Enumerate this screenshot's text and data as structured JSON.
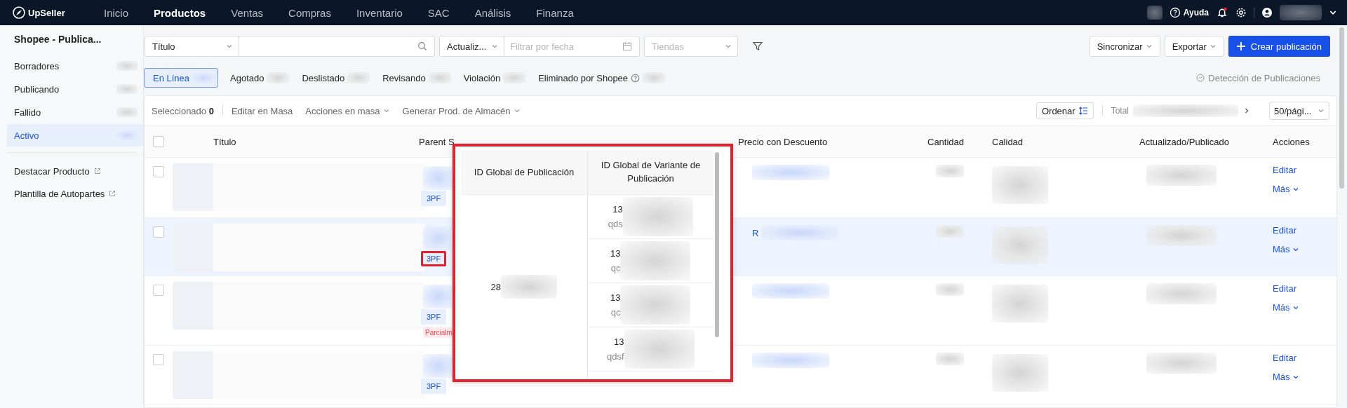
{
  "nav": {
    "logo": "UpSeller",
    "items": [
      {
        "label": "Inicio",
        "selected": false
      },
      {
        "label": "Productos",
        "selected": true
      },
      {
        "label": "Ventas",
        "selected": false
      },
      {
        "label": "Compras",
        "selected": false
      },
      {
        "label": "Inventario",
        "selected": false
      },
      {
        "label": "SAC",
        "selected": false
      },
      {
        "label": "Análisis",
        "selected": false
      },
      {
        "label": "Finanza",
        "selected": false
      }
    ],
    "help": "Ayuda",
    "notification_dot": true
  },
  "sidebar": {
    "title": "Shopee - Publica...",
    "items": [
      {
        "label": "Borradores",
        "selected": false
      },
      {
        "label": "Publicando",
        "selected": false
      },
      {
        "label": "Fallido",
        "selected": false
      },
      {
        "label": "Activo",
        "selected": true
      }
    ],
    "links": [
      "Destacar Producto",
      "Plantilla de Autopartes"
    ]
  },
  "filters": {
    "field_select": "Título",
    "date_select": "Actualiz...",
    "date_field": {
      "placeholder": "Filtrar por fecha"
    },
    "store_select": {
      "placeholder": "Tiendas"
    }
  },
  "actions": [
    {
      "label": "Sincronizar",
      "kind": "menu"
    },
    {
      "label": "Exportar",
      "kind": "menu"
    },
    {
      "label": "Crear publicación",
      "kind": "primary"
    }
  ],
  "status_tabs": [
    {
      "label": "En Línea",
      "selected": true,
      "help": false
    },
    {
      "label": "Agotado",
      "selected": false,
      "help": false
    },
    {
      "label": "Deslistado",
      "selected": false,
      "help": false
    },
    {
      "label": "Revisando",
      "selected": false,
      "help": false
    },
    {
      "label": "Violación",
      "selected": false,
      "help": false
    },
    {
      "label": "Eliminado por Shopee",
      "selected": false,
      "help": true
    }
  ],
  "detection_link": "Detección de Publicaciones",
  "toolbar": {
    "selected_label": "Seleccionado",
    "selected_count": "0",
    "buttons": [
      {
        "label": "Editar en Masa",
        "dropdown": false
      },
      {
        "label": "Acciones en masa",
        "dropdown": true
      },
      {
        "label": "Generar Prod. de Almacén",
        "dropdown": true
      }
    ],
    "sort": "Ordenar",
    "total_label": "Total",
    "page_size": "50/pági..."
  },
  "table": {
    "all_checked": false,
    "columns": [
      "Título",
      "Parent S",
      "Precio con Descuento",
      "Cantidad",
      "Calidad",
      "Actualizado/Publicado",
      "Acciones"
    ],
    "rows": [
      {
        "checked": false,
        "hovered": false,
        "tag": {
          "label": "3PF",
          "highlighted": false
        },
        "actions": [
          "Editar",
          "Más"
        ]
      },
      {
        "checked": false,
        "hovered": true,
        "tag": {
          "label": "3PF",
          "highlighted": true
        },
        "price_text": "R",
        "actions": [
          "Editar",
          "Más"
        ]
      },
      {
        "checked": false,
        "hovered": false,
        "tag": {
          "label": "3PF",
          "highlighted": false
        },
        "status_tag": "Parcialm",
        "actions": [
          "Editar",
          "Más"
        ]
      },
      {
        "checked": false,
        "hovered": false,
        "tag": {
          "label": "3PF",
          "highlighted": false
        },
        "actions": [
          "Editar",
          "Más"
        ]
      }
    ]
  },
  "popup": {
    "highlighted": true,
    "columns": [
      "ID Global de Publicación",
      "ID Global de Variante de Publicación"
    ],
    "listing_id": "28",
    "variants": [
      {
        "id": "13",
        "sku": "qds"
      },
      {
        "id": "13",
        "sku": "qc"
      },
      {
        "id": "13",
        "sku": "qc"
      },
      {
        "id": "13",
        "sku": "qdsf"
      }
    ]
  }
}
